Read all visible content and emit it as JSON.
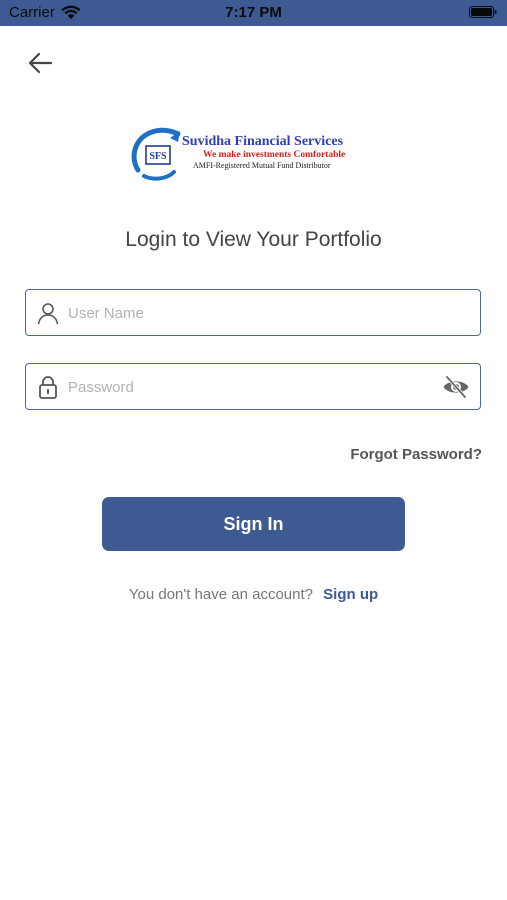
{
  "status_bar": {
    "carrier": "Carrier",
    "time": "7:17 PM"
  },
  "icons": {
    "back": "arrow-left-icon",
    "user": "user-icon",
    "lock": "lock-icon",
    "eye": "eye-slash-icon",
    "wifi": "wifi-icon",
    "battery": "battery-icon"
  },
  "logo": {
    "name": "Suvidha Financial Services",
    "tagline": "We make investments Comfortable",
    "subtitle": "AMFI-Registered Mutual Fund Distributor",
    "badge": "SFS"
  },
  "login": {
    "title": "Login to View Your Portfolio",
    "username_placeholder": "User Name",
    "username_value": "",
    "password_placeholder": "Password",
    "password_value": "",
    "forgot_password": "Forgot Password?",
    "signin_label": "Sign In",
    "no_account_text": "You don't have an account?",
    "signup_label": "Sign up"
  },
  "colors": {
    "primary": "#3e5a93",
    "logo_blue": "#2f3fb6",
    "logo_red": "#d3221d",
    "text": "#444444",
    "placeholder": "#b3b3b3"
  }
}
